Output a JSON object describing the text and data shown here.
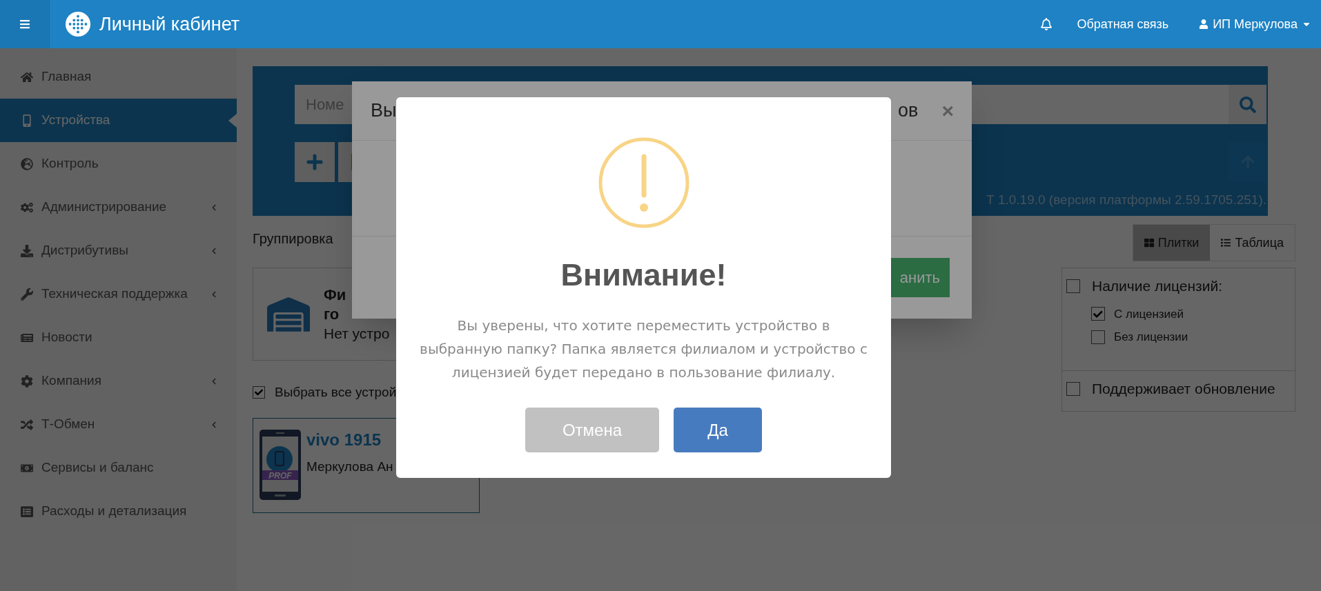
{
  "header": {
    "title": "Личный кабинет",
    "feedback": "Обратная связь",
    "user": "ИП Меркулова"
  },
  "sidebar": {
    "items": [
      {
        "label": "Главная",
        "selected": false,
        "submenu": false
      },
      {
        "label": "Устройства",
        "selected": true,
        "submenu": false
      },
      {
        "label": "Контроль",
        "selected": false,
        "submenu": false
      },
      {
        "label": "Администрирование",
        "selected": false,
        "submenu": true
      },
      {
        "label": "Дистрибутивы",
        "selected": false,
        "submenu": true
      },
      {
        "label": "Техническая поддержка",
        "selected": false,
        "submenu": true
      },
      {
        "label": "Новости",
        "selected": false,
        "submenu": false
      },
      {
        "label": "Компания",
        "selected": false,
        "submenu": true
      },
      {
        "label": "Т-Обмен",
        "selected": false,
        "submenu": true
      },
      {
        "label": "Сервисы и баланс",
        "selected": false,
        "submenu": false
      },
      {
        "label": "Расходы и детализация",
        "selected": false,
        "submenu": false
      }
    ]
  },
  "search": {
    "placeholder": "Номе"
  },
  "version": "Т 1.0.19.0 (версия платформы 2.59.1705.251).",
  "grouping": "Группировка",
  "folder_card": {
    "title_lines": [
      "Фи",
      "го"
    ],
    "subtitle": "Нет устро"
  },
  "select_all": {
    "label": "Выбрать все устрой",
    "checked": true
  },
  "device": {
    "name": "vivo 1915",
    "owner": "Меркулова Ан",
    "badge": "PROF"
  },
  "view_tabs": [
    {
      "label": "Плитки",
      "selected": true
    },
    {
      "label": "Таблица",
      "selected": false
    }
  ],
  "filters": [
    {
      "label": "Наличие лицензий:",
      "checked": false,
      "children": [
        {
          "label": "С лицензией",
          "checked": true
        },
        {
          "label": "Без лицензии",
          "checked": false
        }
      ]
    },
    {
      "label": "Поддерживает обновление",
      "checked": false
    }
  ],
  "move_dialog": {
    "title_start": "Вы",
    "title_end": "ов",
    "close": "×",
    "save_button": "анить"
  },
  "alert": {
    "title": "Внимание!",
    "message": "Вы уверены, что хотите переместить устройство в выбранную папку? Папка является филиалом и устройство с лицензией будет передано в пользование филиалу.",
    "cancel": "Отмена",
    "confirm": "Да"
  }
}
